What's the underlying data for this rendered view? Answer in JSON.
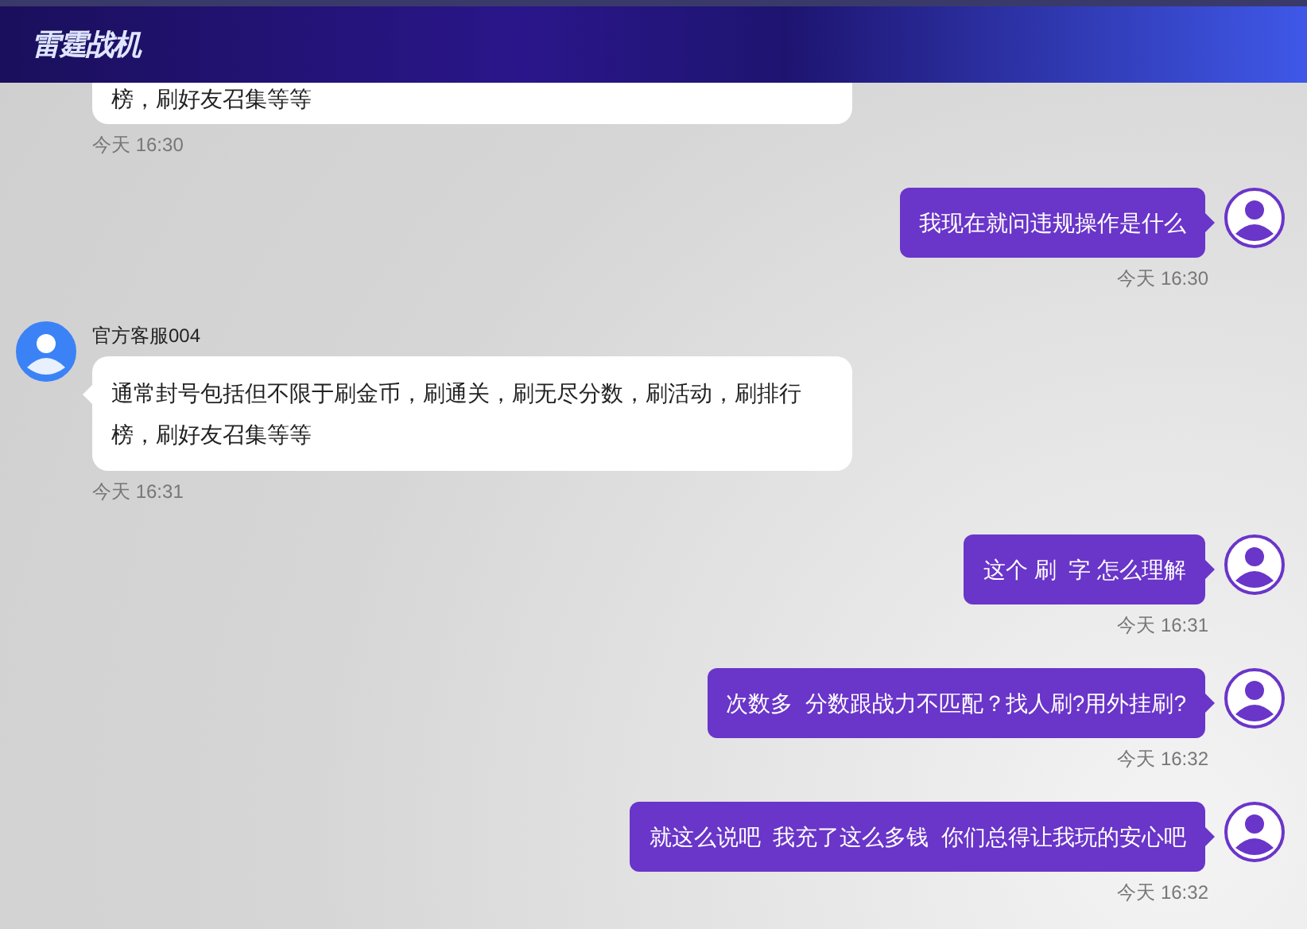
{
  "header": {
    "logo_text": "雷霆战机"
  },
  "messages": [
    {
      "kind": "cut",
      "text": "榜，刷好友召集等等",
      "time": "今天 16:30"
    },
    {
      "kind": "out",
      "text": "我现在就问违规操作是什么",
      "time": "今天 16:30"
    },
    {
      "kind": "in",
      "sender": "官方客服004",
      "text": "通常封号包括但不限于刷金币，刷通关，刷无尽分数，刷活动，刷排行榜，刷好友召集等等",
      "time": "今天 16:31"
    },
    {
      "kind": "out",
      "text": "这个 刷  字 怎么理解",
      "time": "今天 16:31"
    },
    {
      "kind": "out",
      "text": "次数多  分数跟战力不匹配？找人刷?用外挂刷?",
      "time": "今天 16:32"
    },
    {
      "kind": "out",
      "text": "就这么说吧  我充了这么多钱  你们总得让我玩的安心吧",
      "time": "今天 16:32"
    }
  ]
}
